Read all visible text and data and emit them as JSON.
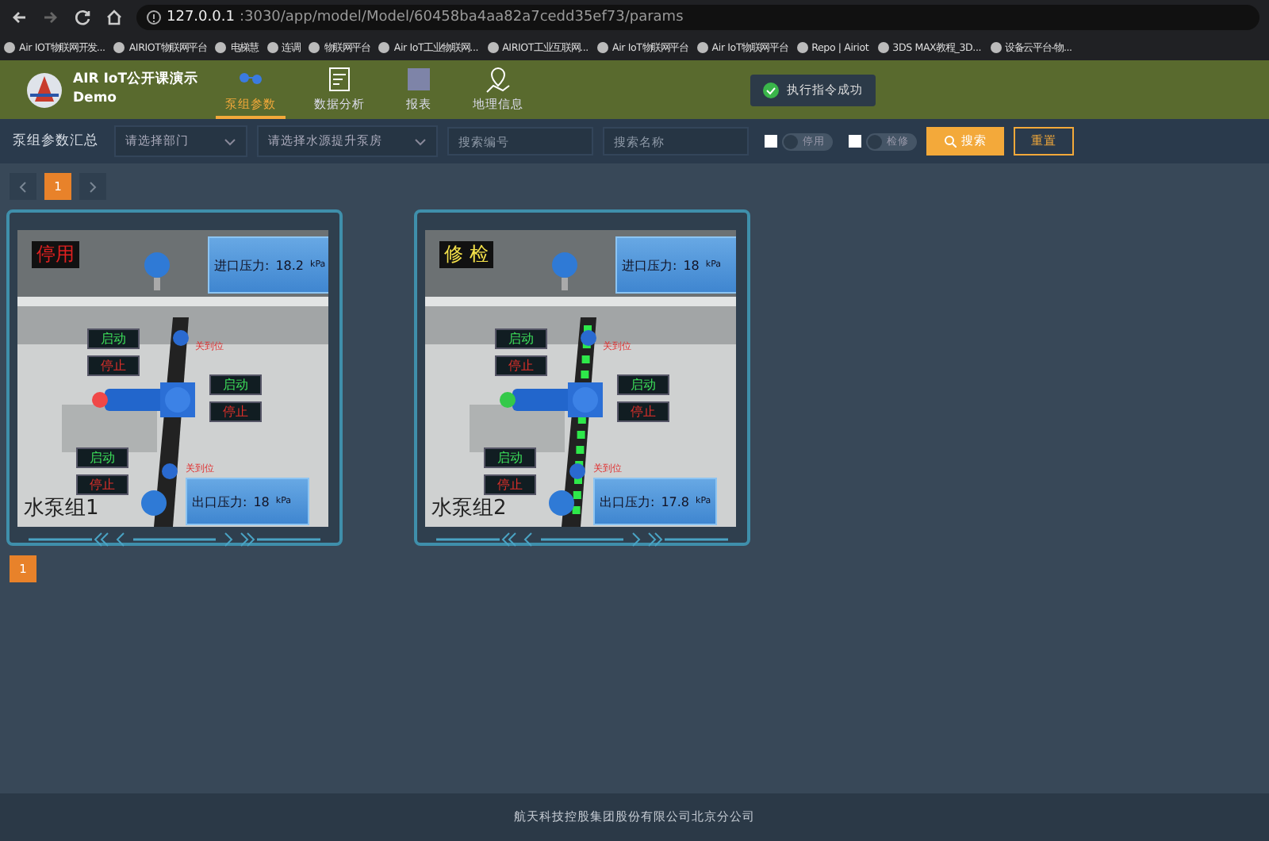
{
  "browser": {
    "url_host": "127.0.0.1",
    "url_rest": ":3030/app/model/Model/60458ba4aa82a7cedd35ef73/params",
    "bookmarks": [
      "Air IOT物联网开发...",
      "AIRIOT物联网平台",
      "电梯慧",
      "连调",
      "物联网平台",
      "Air IoT工业物联网...",
      "AIRIOT工业互联网...",
      "Air IoT物联网平台",
      "Air IoT物联网平台",
      "Repo | Airiot",
      "3DS MAX教程_3D...",
      "设备云平台-物..."
    ]
  },
  "header": {
    "app_name": "AIR IoT公开课演示Demo",
    "nav": [
      {
        "label": "泵组参数",
        "selected": true
      },
      {
        "label": "数据分析",
        "selected": false
      },
      {
        "label": "报表",
        "selected": false
      },
      {
        "label": "地理信息",
        "selected": false
      }
    ],
    "toast": "执行指令成功"
  },
  "filter": {
    "title": "泵组参数汇总",
    "dropdowns": [
      {
        "placeholder": "请选择部门"
      },
      {
        "placeholder": "请选择水源提升泵房"
      }
    ],
    "search_fields": [
      {
        "placeholder": "搜索编号"
      },
      {
        "placeholder": "搜索名称"
      }
    ],
    "toggles": [
      {
        "label": "停用",
        "checked": false,
        "on": false
      },
      {
        "label": "检修",
        "checked": false,
        "on": false
      }
    ],
    "buttons": [
      {
        "label": "搜索",
        "kind": "primary"
      },
      {
        "label": "重置",
        "kind": "outline"
      }
    ]
  },
  "pager_top": {
    "pages": [
      {
        "label": "1",
        "selected": true
      }
    ]
  },
  "pumps": [
    {
      "name": "水泵组1",
      "status": "停用",
      "maintenance": false,
      "running": false,
      "inlet_label": "进口压力:",
      "inlet_value": "18.2",
      "inlet_unit": "kPa",
      "outlet_label": "出口压力:",
      "outlet_value": "18",
      "outlet_unit": "kPa",
      "valves": [
        "关到位",
        "关到位"
      ],
      "controls": [
        {
          "start": "启动",
          "stop": "停止"
        },
        {
          "start": "启动",
          "stop": "停止"
        },
        {
          "start": "启动",
          "stop": "停止"
        }
      ]
    },
    {
      "name": "水泵组2",
      "status": "修 检",
      "maintenance": true,
      "running": true,
      "inlet_label": "进口压力:",
      "inlet_value": "18",
      "inlet_unit": "kPa",
      "outlet_label": "出口压力:",
      "outlet_value": "17.8",
      "outlet_unit": "kPa",
      "valves": [
        "关到位",
        "关到位"
      ],
      "controls": [
        {
          "start": "启动",
          "stop": "停止"
        },
        {
          "start": "启动",
          "stop": "停止"
        },
        {
          "start": "启动",
          "stop": "停止"
        }
      ]
    }
  ],
  "pager_bottom": {
    "pages": [
      {
        "label": "1",
        "selected": true
      }
    ]
  },
  "footer": "航天科技控股集团股份有限公司北京分公司"
}
